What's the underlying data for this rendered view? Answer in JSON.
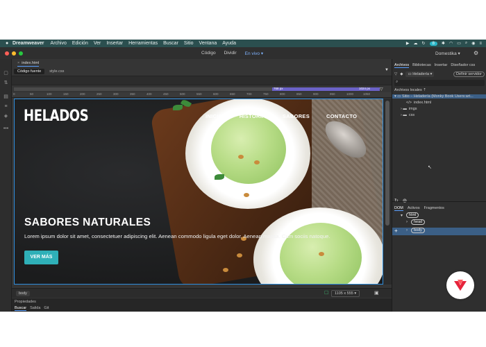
{
  "menubar": {
    "app_name": "Dreamweaver",
    "items": [
      "Archivo",
      "Edición",
      "Ver",
      "Insertar",
      "Herramientas",
      "Buscar",
      "Sitio",
      "Ventana",
      "Ayuda"
    ],
    "status_badge": "8"
  },
  "titlebar": {
    "views": [
      "Código",
      "Dividir",
      "En vivo"
    ],
    "active_view": "En vivo",
    "workspace": "Domestika"
  },
  "document": {
    "tab": "index.html",
    "file_tabs": [
      "Código fuente",
      "style.css"
    ],
    "ruler_labels": [
      "0",
      "50",
      "100",
      "150",
      "200",
      "250",
      "300",
      "350",
      "400",
      "450",
      "500",
      "550",
      "600",
      "650",
      "700",
      "750",
      "800",
      "850",
      "900",
      "950",
      "1000",
      "1050"
    ],
    "mq_labels": [
      "768 px",
      "1024 px"
    ]
  },
  "live_page": {
    "logo": "HELADOS",
    "nav": [
      "INICIO",
      "HISTORIA",
      "SABORES",
      "CONTACTO"
    ],
    "hero_title": "SABORES NATURALES",
    "hero_text": "Lorem ipsum dolor sit amet, consectetuer adipiscing elit. Aenean commodo ligula eget dolor. Aenean massa. Cum sociis natoque.",
    "cta": "VER MÁS"
  },
  "statusbar": {
    "tag": "body",
    "size": "1105 x 555"
  },
  "properties": {
    "title": "Propiedades",
    "tabs": [
      "Buscar",
      "Salida",
      "Git"
    ]
  },
  "right_panel": {
    "tabs": [
      "Archivos",
      "Bibliotecas",
      "Insertar",
      "Diseñador css"
    ],
    "site": "Heladería",
    "server_button": "Definir servidor",
    "tree_title": "Archivos locales",
    "root": "Sitio – Heladería (Monky Book Users:art...",
    "files": [
      "index.html",
      "imgs",
      "css"
    ],
    "dom_tabs": [
      "DOM",
      "Activos",
      "Fragmentos"
    ],
    "dom_nodes": [
      "html",
      "head",
      "body"
    ]
  },
  "colors": {
    "accent": "#2fb0b8",
    "menubar": "#2b4f4f",
    "selection": "#3b5f86"
  }
}
